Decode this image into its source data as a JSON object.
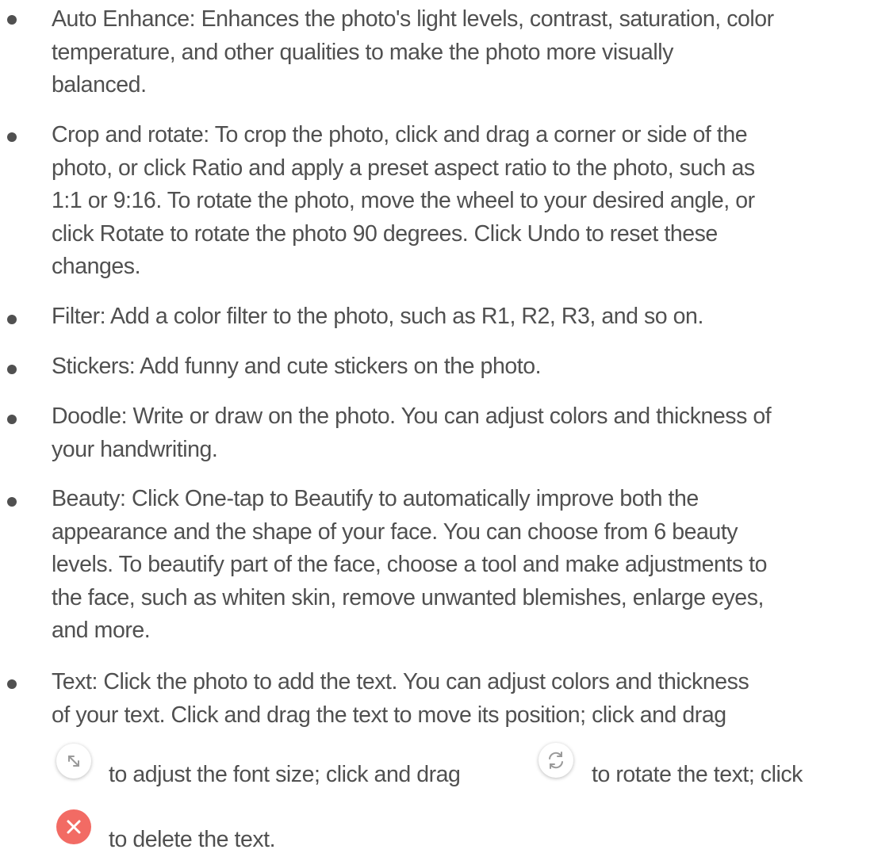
{
  "items": [
    {
      "lines": [
        "Auto Enhance: Enhances the photo's light levels, contrast, saturation, color",
        "temperature, and other qualities to make the photo more visually",
        "balanced."
      ]
    },
    {
      "lines": [
        "Crop and rotate: To crop the photo, click and drag a corner or side of the",
        "photo, or click Ratio and apply a preset aspect ratio to the photo, such as",
        "1:1 or 9:16. To rotate the photo, move the wheel to your desired angle, or",
        "click Rotate to rotate the photo 90 degrees. Click Undo to reset these",
        "changes."
      ]
    },
    {
      "lines": [
        "Filter: Add a color filter to the photo, such as R1, R2, R3, and so on."
      ]
    },
    {
      "lines": [
        "Stickers: Add funny and cute stickers on the photo."
      ]
    },
    {
      "lines": [
        "Doodle: Write or draw on the photo. You can adjust colors and thickness of",
        "your handwriting."
      ]
    },
    {
      "lines": [
        "Beauty: Click One-tap to Beautify to automatically improve both the",
        "appearance and the shape of your face. You can choose from 6 beauty",
        "levels. To beautify part of the face, choose a tool and make adjustments to",
        "the face, such as whiten skin, remove unwanted blemishes, enlarge eyes,",
        "and more."
      ]
    },
    {
      "lines": [
        "Text: Click the photo to add the text. You can adjust colors and thickness",
        "of your text. Click and drag the text to move its position; click and drag"
      ],
      "resize_text": "to adjust the font size; click and drag",
      "rotate_text": "to rotate the text; click",
      "delete_text": "to delete the text."
    }
  ],
  "icons": {
    "resize": "resize-arrow-icon",
    "rotate": "rotate-icon",
    "delete": "delete-x-icon",
    "delete_color": "#f26b64"
  }
}
